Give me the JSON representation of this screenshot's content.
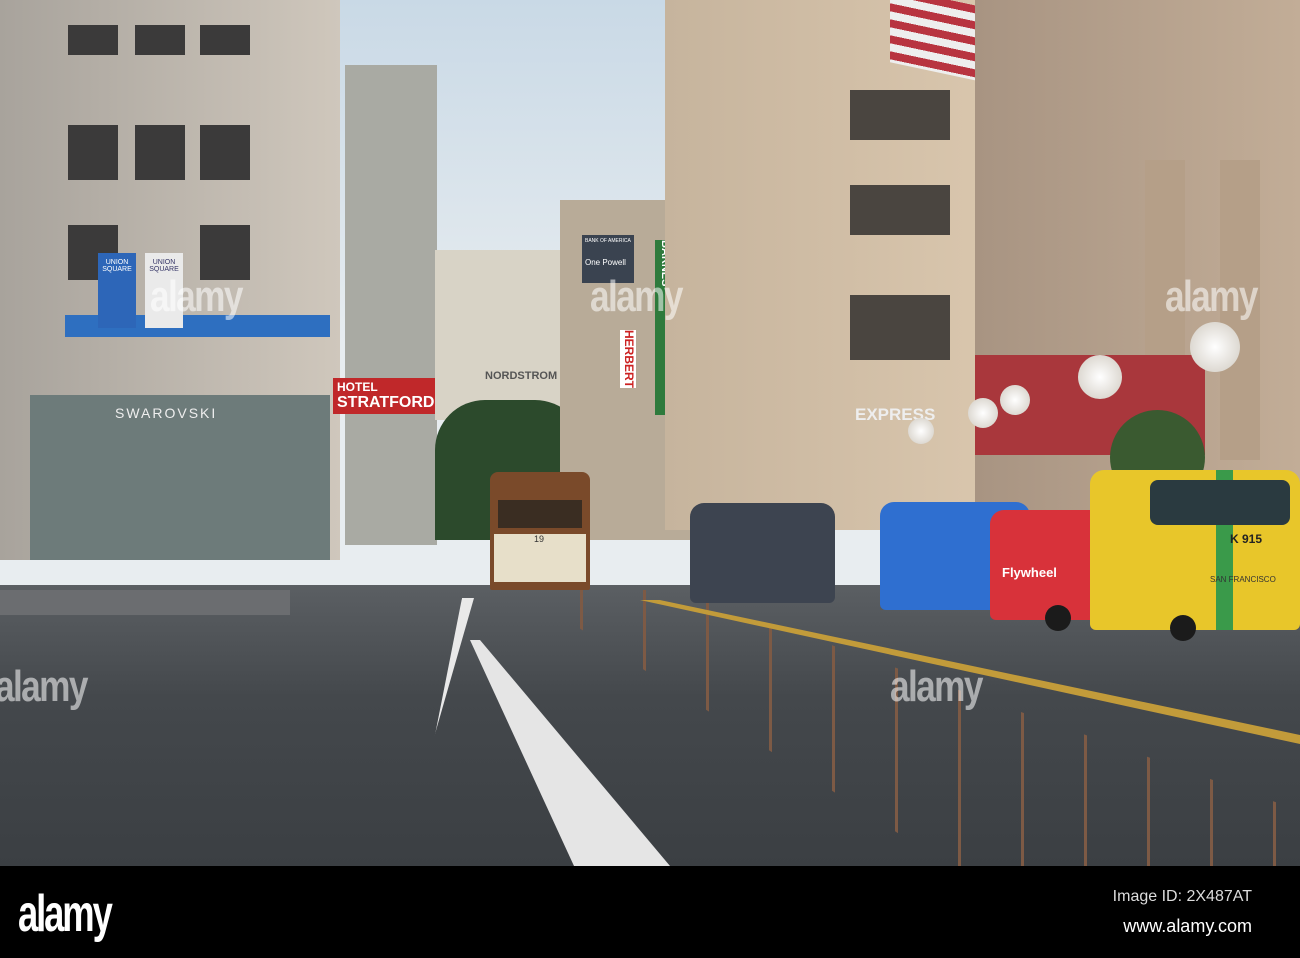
{
  "watermark": {
    "text": "alamy"
  },
  "footer": {
    "logo": "alamy",
    "image_id": "Image ID: 2X487AT",
    "website": "www.alamy.com"
  },
  "signs": {
    "swarovski": "SWAROVSKI",
    "union_square": "UNION SQUARE",
    "stratford": "STRATFORD",
    "hotel": "HOTEL",
    "nordstrom": "NORDSTROM",
    "one_powell": "One Powell",
    "bank_of_america": "BANK OF AMERICA",
    "herbert": "HERBERT",
    "barnes": "BARNES",
    "express": "EXPRESS",
    "cable_car_number": "19",
    "taxi_id": "K 915",
    "flywheel": "Flywheel",
    "san_francisco": "SAN FRANCISCO"
  },
  "colors": {
    "sky": "#c9d9e6",
    "taxi_yellow": "#e8c62a",
    "taxi_blue": "#2f6fd0",
    "taxi_red": "#d8323a",
    "cable_car": "#7a4a2a"
  }
}
